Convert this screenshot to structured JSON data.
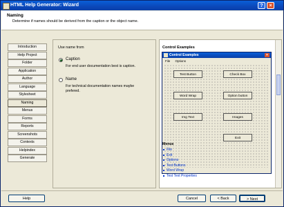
{
  "window": {
    "title": "HTML Help Generator: Wizard"
  },
  "header": {
    "title": "Naming",
    "description": "Determine if names should be derived from the caption or the object name."
  },
  "sidebar": {
    "items": [
      "Introduction",
      "Help Project",
      "Folder",
      "Application",
      "Author",
      "Language",
      "Stylesheet",
      "Naming",
      "Menus",
      "Forms",
      "Reports",
      "Screenshots",
      "Contexts",
      "Helpindex",
      "Generate"
    ],
    "active": "Naming"
  },
  "naming": {
    "label": "Use name from",
    "options": [
      {
        "label": "Caption",
        "desc": "For end user documentation best is caption.",
        "selected": true
      },
      {
        "label": "Name",
        "desc": "For technical documentation names maybe prefered.",
        "selected": false
      }
    ]
  },
  "preview": {
    "title": "Control Examples",
    "window_title": "Control Examples",
    "menu": [
      "File",
      "Options"
    ],
    "buttons": [
      "Test Button",
      "Check Box",
      "Word Wrap",
      "Option button",
      "Img Text",
      "Images",
      "Exit"
    ],
    "list_heading": "Menus",
    "list_items": [
      "File",
      "Exit",
      "Options",
      "Test Buttons",
      "Word Wrap",
      "Test Text Properties"
    ]
  },
  "footer": {
    "help": "Help",
    "cancel": "Cancel",
    "back": "< Back",
    "next": "> Next"
  }
}
